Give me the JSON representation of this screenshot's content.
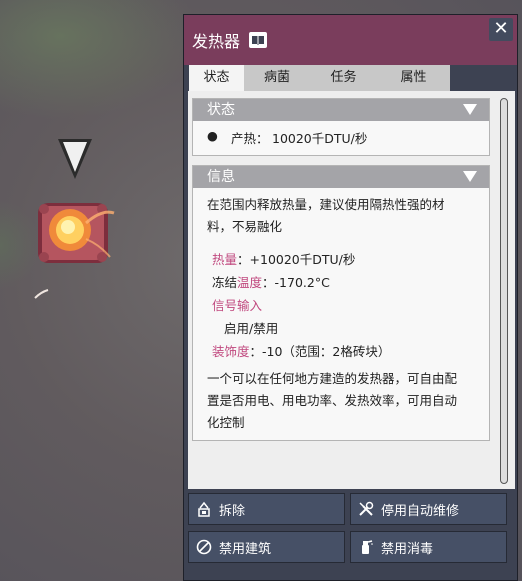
{
  "panel": {
    "title": "发热器",
    "close_label": "✕",
    "tabs": [
      "状态",
      "病菌",
      "任务",
      "属性"
    ],
    "active_tab": "状态"
  },
  "status_section": {
    "header": "状态",
    "bullet_label": "产热",
    "bullet_value": "10020千DTU/秒"
  },
  "info_section": {
    "header": "信息",
    "description_line1": "在范围内释放热量，建议使用隔热性强的材",
    "description_line2": "料，不易融化",
    "heat_label": "热量",
    "heat_value": "：+10020千DTU/秒",
    "freeze_prefix": "冻结",
    "freeze_label": "温度",
    "freeze_value": "：-170.2°C",
    "signal_label": "信号输入",
    "signal_value": "启用/禁用",
    "decor_label": "装饰度",
    "decor_value": "：-10（范围：2格砖块）",
    "summary_line1": "一个可以在任何地方建造的发热器，可自由配",
    "summary_line2": "置是否用电、用电功率、发热效率，可用自动",
    "summary_line3": "化控制"
  },
  "buttons": {
    "deconstruct": "拆除",
    "disable_auto_repair": "停用自动维修",
    "disable_building": "禁用建筑",
    "disable_disinfect": "禁用消毒"
  },
  "colors": {
    "title_bar": "#7a3d5c",
    "panel_bg": "#3d4252",
    "highlight_text": "#c0487e",
    "section_header": "#a4a4a8"
  }
}
